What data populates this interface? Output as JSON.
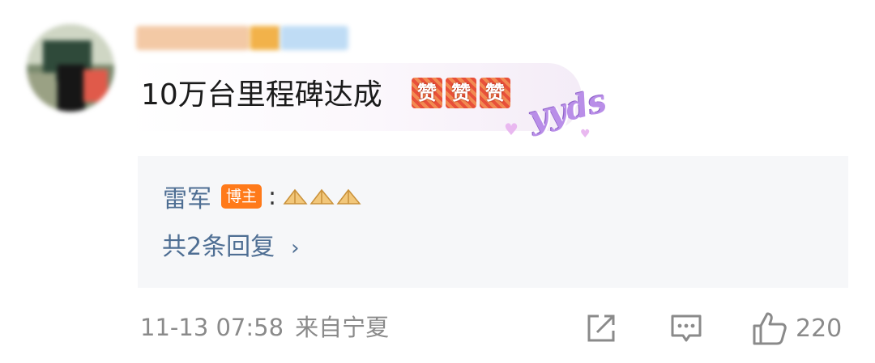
{
  "comment": {
    "text": "10万台里程碑达成",
    "emoji_labels": [
      "赞",
      "赞",
      "赞"
    ],
    "sticker": "yyds"
  },
  "reply": {
    "author": "雷军",
    "badge": "博主",
    "colon": ":",
    "emoji": [
      "pray-hands",
      "pray-hands",
      "pray-hands"
    ],
    "count_label": "共2条回复",
    "chevron": "›"
  },
  "meta": {
    "timestamp": "11-13 07:58",
    "location": "来自宁夏"
  },
  "actions": {
    "share_icon": "share-icon",
    "comment_icon": "comment-icon",
    "like_icon": "thumbs-up-icon",
    "like_count": "220"
  },
  "colors": {
    "link": "#4e6e93",
    "badge": "#ff7a1a",
    "reply_bg": "#f6f7f9",
    "meta": "#8a8a8a"
  }
}
